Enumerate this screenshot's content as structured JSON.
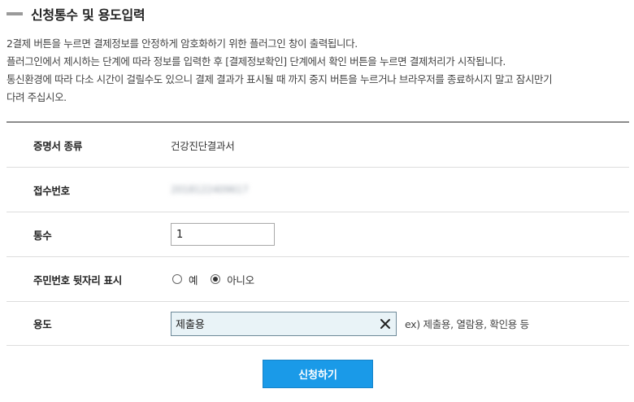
{
  "section": {
    "title": "신청통수 및 용도입력"
  },
  "notice": {
    "line1": "2결제 버튼을 누르면 결제정보를 안정하게 암호화하기 위한 플러그인 창이 출력됩니다.",
    "line2": "플러그인에서 제시하는 단계에 따라 정보를 입력한 후 [결제정보확인] 단계에서 확인 버튼을 누르면 결제처리가 시작됩니다.",
    "line3": "통신환경에 따라 다소 시간이 걸릴수도 있으니 결제 결과가 표시될 때 까지 중지 버튼을 누르거나 브라우저를 종료하시지 말고 잠시만기",
    "line4": "다려 주십시오."
  },
  "form": {
    "cert_type_label": "증명서 종류",
    "cert_type_value": "건강진단결과서",
    "receipt_label": "접수번호",
    "receipt_value": "2018122409617",
    "count_label": "통수",
    "count_value": "1",
    "id_display_label": "주민번호 뒷자리 표시",
    "id_display_options": [
      "예",
      "아니오"
    ],
    "id_display_selected": "아니오",
    "use_label": "용도",
    "use_value": "제출용",
    "use_hint": "ex) 제출용, 열람용, 확인용 등"
  },
  "actions": {
    "submit_label": "신청하기"
  },
  "icons": {
    "clear": "close-icon",
    "section_marker": "section-bar-icon"
  },
  "colors": {
    "submit_bg": "#1a9ae8",
    "input_active_bg": "#e9f3f7"
  }
}
